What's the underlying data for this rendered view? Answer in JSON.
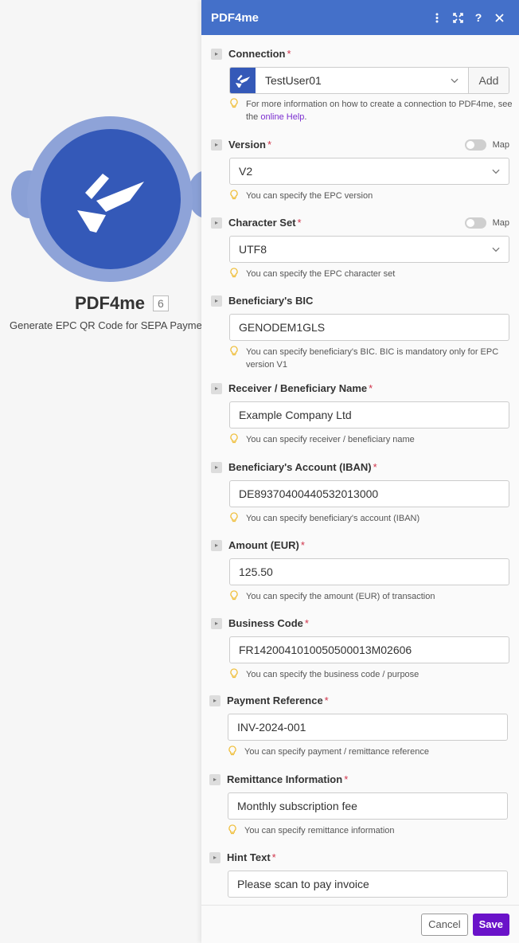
{
  "node": {
    "title": "PDF4me",
    "badge": "6",
    "subtitle": "Generate EPC QR Code for SEPA Payments",
    "color": "#3459b8"
  },
  "panel": {
    "title": "PDF4me",
    "header_icons": [
      "more-vertical-icon",
      "expand-icon",
      "help-icon",
      "close-icon"
    ],
    "header_color": "#4470c9"
  },
  "fields": {
    "connection": {
      "label": "Connection",
      "required": "*",
      "value": "TestUser01",
      "add_label": "Add",
      "hint_text": "For more information on how to create a connection to PDF4me, see the ",
      "hint_link": "online Help",
      "hint_tail": "."
    },
    "version": {
      "label": "Version",
      "required": "*",
      "map_label": "Map",
      "value": "V2",
      "hint": "You can specify the EPC version"
    },
    "charset": {
      "label": "Character Set",
      "required": "*",
      "map_label": "Map",
      "value": "UTF8",
      "hint": "You can specify the EPC character set"
    },
    "bic": {
      "label": "Beneficiary's BIC",
      "value": "GENODEM1GLS",
      "hint": "You can specify beneficiary's BIC. BIC is mandatory only for EPC version V1"
    },
    "receiver": {
      "label": "Receiver / Beneficiary Name",
      "required": "*",
      "value": "Example Company Ltd",
      "hint": "You can specify receiver / beneficiary name"
    },
    "iban": {
      "label": "Beneficiary's Account (IBAN)",
      "required": "*",
      "value": "DE89370400440532013000",
      "hint": "You can specify beneficiary's account (IBAN)"
    },
    "amount": {
      "label": "Amount (EUR)",
      "required": "*",
      "value": "125.50",
      "hint": "You can specify the amount (EUR) of transaction"
    },
    "business_code": {
      "label": "Business Code",
      "required": "*",
      "value": "FR1420041010050500013M02606",
      "hint": "You can specify the business code / purpose"
    },
    "payment_ref": {
      "label": "Payment Reference",
      "required": "*",
      "value": "INV-2024-001",
      "hint": "You can specify payment / remittance reference"
    },
    "remittance": {
      "label": "Remittance Information",
      "required": "*",
      "value": "Monthly subscription fee",
      "hint": "You can specify remittance information"
    },
    "hint_text": {
      "label": "Hint Text",
      "required": "*",
      "value": "Please scan to pay invoice"
    }
  },
  "footer": {
    "cancel_label": "Cancel",
    "save_label": "Save",
    "save_color": "#6a12c9"
  }
}
